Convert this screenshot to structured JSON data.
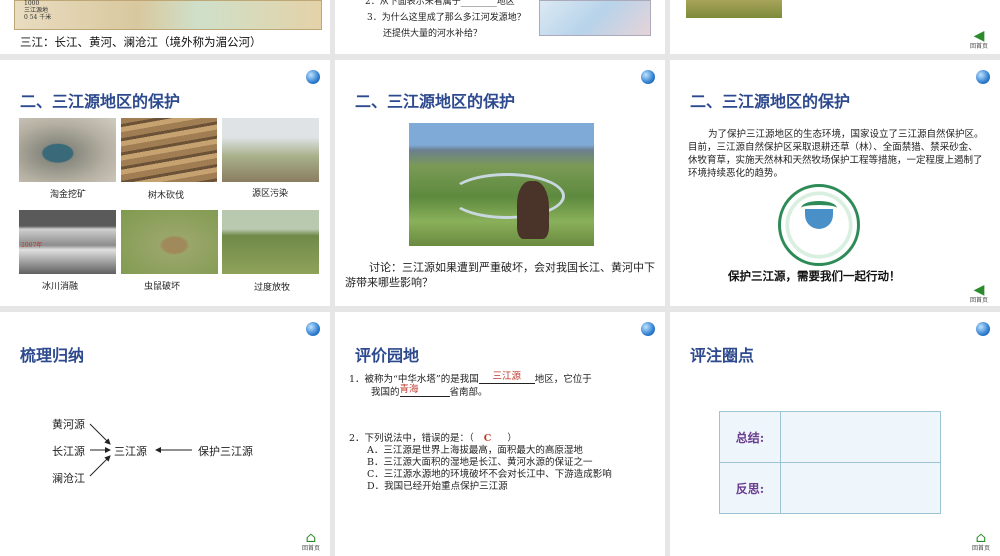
{
  "slides": {
    "s1": {
      "caption": "三江：长江、黄河、澜沧江（境外称为湄公河）",
      "legend": [
        "1000",
        "三江源地",
        "0 54 千米"
      ]
    },
    "s2": {
      "q2": "2．从下面表示来看属于________地区",
      "q3": "3．为什么这里成了那么多江河发源地？",
      "q3b": "还提供大量的河水补给？"
    },
    "s4": {
      "title": "二、三江源地区的保护",
      "captions": [
        "淘金挖矿",
        "树木砍伐",
        "源区污染",
        "冰川消融",
        "虫鼠破坏",
        "过度放牧"
      ],
      "year": "2007年"
    },
    "s5": {
      "title": "二、三江源地区的保护",
      "discussion": "讨论：三江源如果遭到严重破坏，会对我国长江、黄河中下游带来哪些影响？"
    },
    "s6": {
      "title": "二、三江源地区的保护",
      "paragraph": "为了保护三江源地区的生态环境，国家设立了三江源自然保护区。目前，三江源自然保护区采取退耕还草（林）、全面禁猎、禁采砂金、休牧育草，实施天然林和天然牧场保护工程等措施，一定程度上遏制了环境持续恶化的趋势。",
      "slogan": "保护三江源，需要我们一起行动！"
    },
    "s7": {
      "title": "梳理归纳",
      "rivers": [
        "黄河源",
        "长江源",
        "澜沧江"
      ],
      "center": "三江源",
      "protect": "保护三江源"
    },
    "s8": {
      "title": "评价园地",
      "q1a": "1．被称为“中华水塔”的是我国",
      "q1_ans1": "三江源",
      "q1b": "地区，它位于",
      "q1c": "我国的",
      "q1_ans2": "青海",
      "q1d": "省南部。",
      "q2": "2．下列说法中，错误的是：（",
      "q2_ans": "C",
      "q2_end": "）",
      "options": [
        "A．三江源是世界上海拔最高，面积最大的高原湿地",
        "B．三江源大面积的湿地是长江、黄河水源的保证之一",
        "C．三江源水源地的环境破坏不会对长江中、下游造成影响",
        "D．我国已经开始重点保护三江源"
      ]
    },
    "s9": {
      "title": "评注圈点",
      "rows": [
        "总结:",
        "反思:"
      ]
    },
    "nav": {
      "home_label": "回首页"
    },
    "colors": {
      "title": "#2e4a8e",
      "answer": "#c0392b",
      "purple": "#6a3d8f"
    }
  }
}
